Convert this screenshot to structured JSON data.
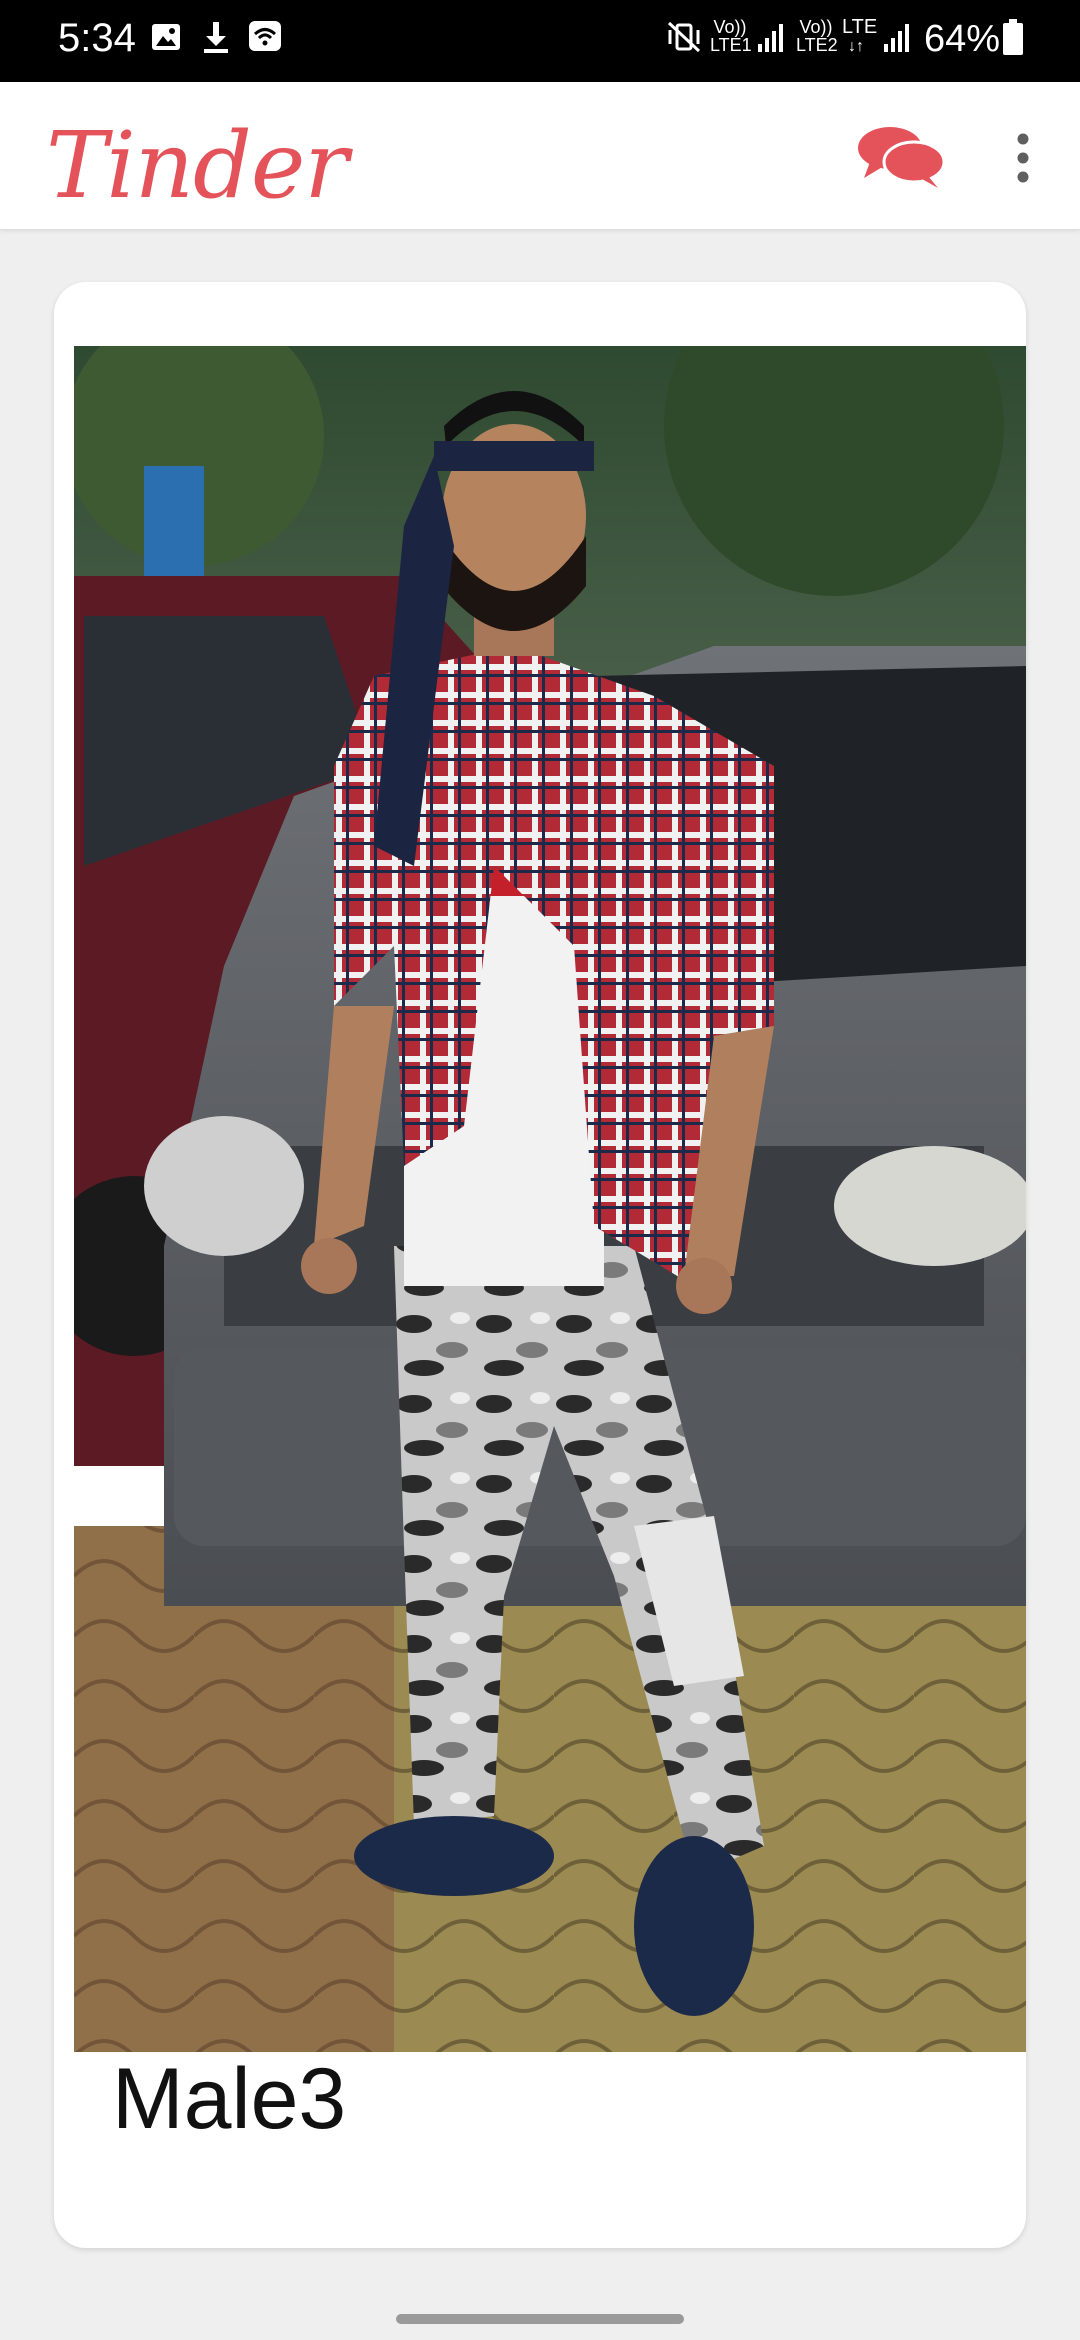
{
  "status_bar": {
    "time": "5:34",
    "battery": "64%",
    "sim1_tag": "Vo)) LTE1",
    "sim2_tag": "Vo)) LTE2",
    "network": "LTE",
    "icons": [
      "image-icon",
      "download-icon",
      "wifi-icon",
      "vibrate-mute-icon",
      "signal-icon",
      "battery-icon"
    ]
  },
  "app_bar": {
    "title": "Tinder",
    "actions": [
      "chat-icon",
      "more-vert-icon"
    ]
  },
  "colors": {
    "brand": "#e5535a",
    "background": "#efefef",
    "card": "#ffffff"
  },
  "card": {
    "name": "Male3",
    "photo_subject": "man-standing-in-front-of-cars"
  }
}
